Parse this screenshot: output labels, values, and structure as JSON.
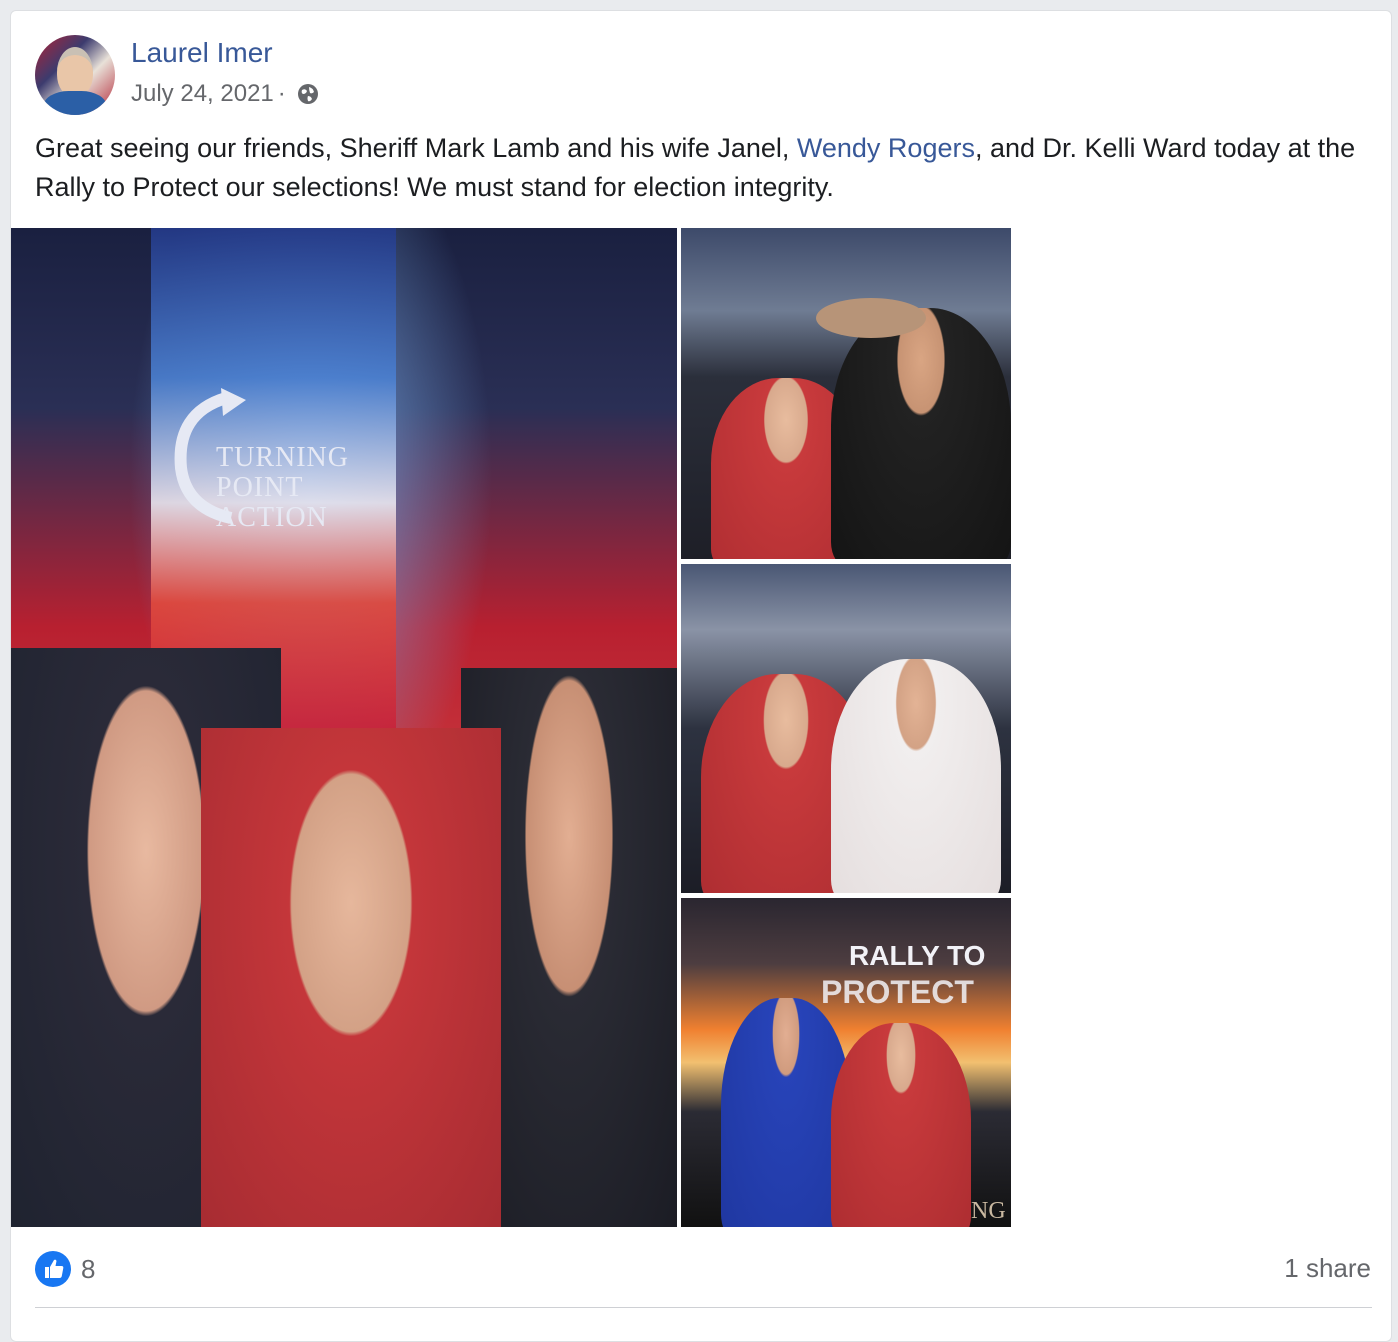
{
  "post": {
    "author": "Laurel Imer",
    "date": "July 24, 2021",
    "separator": "·",
    "privacy_icon": "globe-icon",
    "text_before_mention": "Great seeing our friends, Sheriff Mark Lamb and his wife Janel, ",
    "mention": "Wendy Rogers",
    "text_after_mention": ", and Dr. Kelli Ward today at the Rally to Protect our selections! We must stand for election integrity."
  },
  "photos": {
    "main_banner_line1": "TURNING",
    "main_banner_line2": "POINT ACTION",
    "third_banner_line1": "RALLY TO",
    "third_banner_line2": "PROTECT",
    "third_corner_text": "NG"
  },
  "footer": {
    "like_icon": "thumbs-up-icon",
    "like_count": "8",
    "shares": "1 share"
  },
  "colors": {
    "link": "#385898",
    "secondary_text": "#65676b",
    "like_blue": "#1877f2"
  }
}
